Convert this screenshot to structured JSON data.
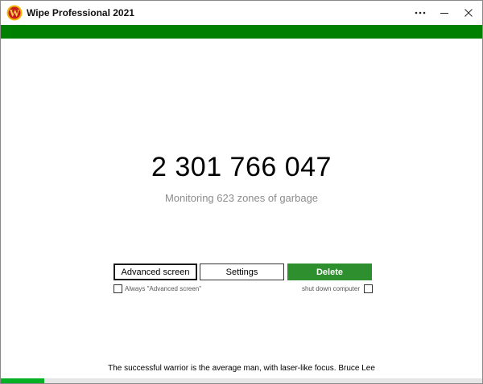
{
  "window": {
    "title": "Wipe Professional 2021",
    "logo_letter": "W",
    "controls": {
      "more_icon": "more-icon",
      "minimize_icon": "minimize-icon",
      "close_icon": "close-icon"
    }
  },
  "colors": {
    "header_green": "#008000",
    "delete_green": "#2d8f2d",
    "progress_green": "#06b025"
  },
  "main": {
    "counter": "2 301 766 047",
    "monitoring_text": "Monitoring 623 zones of garbage"
  },
  "buttons": {
    "advanced_label": "Advanced screen",
    "settings_label": "Settings",
    "delete_label": "Delete"
  },
  "options": {
    "always_advanced_label": "Always \"Advanced screen\"",
    "always_advanced_checked": false,
    "shutdown_label": "shut down computer",
    "shutdown_checked": false
  },
  "footer": {
    "quote": "The successful warrior is the average man, with laser-like focus. Bruce Lee",
    "progress_fraction": 0.09
  }
}
